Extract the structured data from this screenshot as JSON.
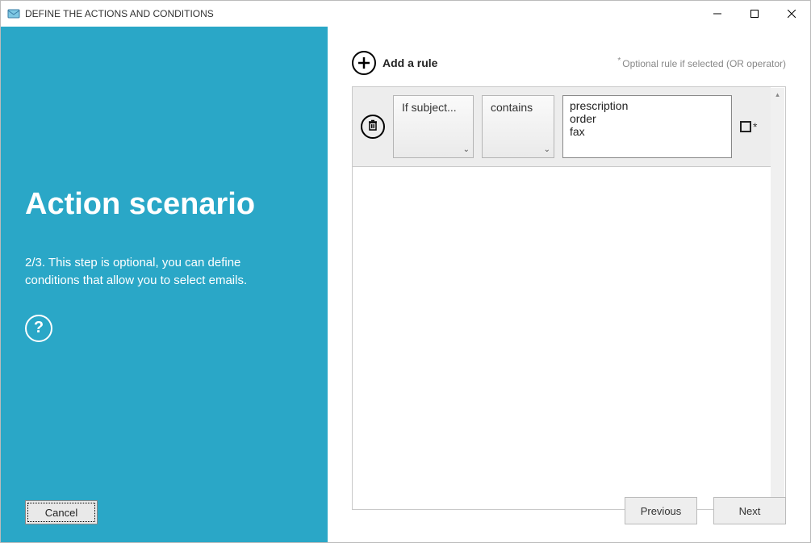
{
  "window": {
    "title": "DEFINE THE ACTIONS AND CONDITIONS"
  },
  "sidebar": {
    "heading": "Action scenario",
    "step_text": "2/3. This step is optional, you can define conditions that allow you to select emails.",
    "cancel_label": "Cancel"
  },
  "main": {
    "add_rule_label": "Add a rule",
    "hint_text": "Optional rule if selected (OR operator)",
    "rules": [
      {
        "field_label": "If subject...",
        "operator_label": "contains",
        "value_text": "prescription\norder\nfax",
        "optional_checked": false
      }
    ],
    "previous_label": "Previous",
    "next_label": "Next"
  }
}
